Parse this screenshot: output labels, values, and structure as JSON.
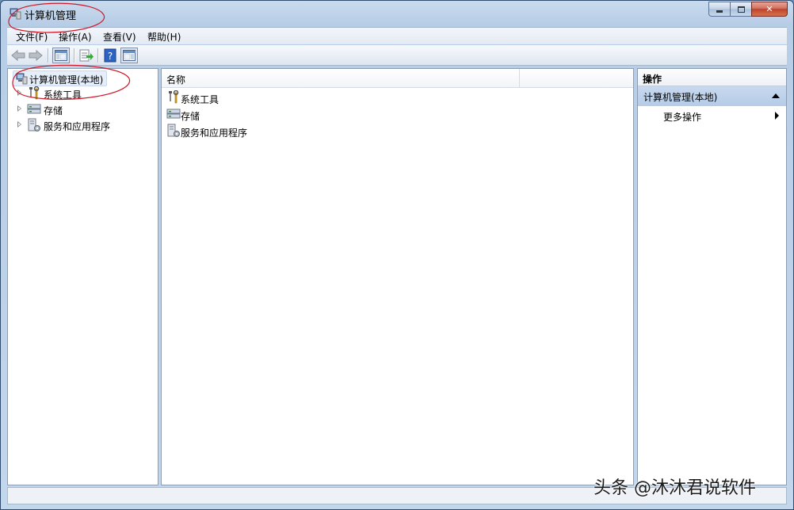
{
  "window": {
    "title": "计算机管理",
    "icon": "computer-management-icon"
  },
  "menu": {
    "file": "文件(F)",
    "action": "操作(A)",
    "view": "查看(V)",
    "help": "帮助(H)"
  },
  "toolbar": {
    "icons": [
      "back-arrow-icon",
      "forward-arrow-icon",
      "show-hide-tree-icon",
      "export-list-icon",
      "help-icon",
      "show-hide-action-pane-icon"
    ]
  },
  "tree": {
    "root": "计算机管理(本地)",
    "items": [
      {
        "label": "系统工具",
        "icon": "tools-icon"
      },
      {
        "label": "存储",
        "icon": "storage-icon"
      },
      {
        "label": "服务和应用程序",
        "icon": "services-icon"
      }
    ]
  },
  "list": {
    "column_name": "名称",
    "items": [
      {
        "label": "系统工具",
        "icon": "tools-icon"
      },
      {
        "label": "存储",
        "icon": "storage-icon"
      },
      {
        "label": "服务和应用程序",
        "icon": "services-icon"
      }
    ]
  },
  "actions": {
    "title": "操作",
    "section": "计算机管理(本地)",
    "more": "更多操作"
  },
  "watermark": "头条 @沐沐君说软件",
  "colors": {
    "annotation": "#d0182a",
    "selection": "#e6eef9",
    "action_section": "#c0d4ec"
  }
}
